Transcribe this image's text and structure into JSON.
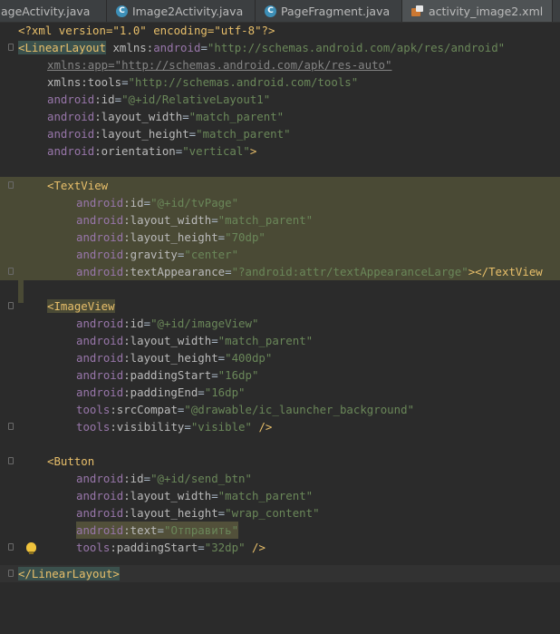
{
  "tabs": [
    {
      "label": "ageActivity.java",
      "icon": "none"
    },
    {
      "label": "Image2Activity.java",
      "icon": "java-class-icon"
    },
    {
      "label": "PageFragment.java",
      "icon": "java-class-icon"
    },
    {
      "label": "activity_image2.xml",
      "icon": "xml-layout-icon"
    }
  ],
  "icon_letter": "C",
  "code": {
    "l1": {
      "a": "<?xml version=\"1.0\" encoding=\"utf-8\"?>"
    },
    "l2": {
      "tag": "<LinearLayout",
      "ns": "xmlns:",
      "attr": "android",
      "eq": "=",
      "val": "\"http://schemas.android.com/apk/res/android\""
    },
    "l3": {
      "attr": "xmlns:app",
      "eq": "=",
      "val": "\"http://schemas.android.com/apk/res-auto\""
    },
    "l4": {
      "attr": "xmlns:tools",
      "eq": "=",
      "val": "\"http://schemas.android.com/tools\""
    },
    "l5": {
      "ns": "android",
      "attr": ":id",
      "eq": "=",
      "val": "\"@+id/RelativeLayout1\""
    },
    "l6": {
      "ns": "android",
      "attr": ":layout_width",
      "eq": "=",
      "val": "\"match_parent\""
    },
    "l7": {
      "ns": "android",
      "attr": ":layout_height",
      "eq": "=",
      "val": "\"match_parent\""
    },
    "l8": {
      "ns": "android",
      "attr": ":orientation",
      "eq": "=",
      "val": "\"vertical\"",
      "end": ">"
    },
    "l10": {
      "tag": "<TextView"
    },
    "l11": {
      "ns": "android",
      "attr": ":id",
      "eq": "=",
      "val": "\"@+id/tvPage\""
    },
    "l12": {
      "ns": "android",
      "attr": ":layout_width",
      "eq": "=",
      "val": "\"match_parent\""
    },
    "l13": {
      "ns": "android",
      "attr": ":layout_height",
      "eq": "=",
      "val": "\"70dp\""
    },
    "l14": {
      "ns": "android",
      "attr": ":gravity",
      "eq": "=",
      "val": "\"center\""
    },
    "l15": {
      "ns": "android",
      "attr": ":textAppearance",
      "eq": "=",
      "val": "\"?android:attr/textAppearanceLarge\"",
      "end": "></TextView"
    },
    "l17": {
      "tag": "<ImageView"
    },
    "l18": {
      "ns": "android",
      "attr": ":id",
      "eq": "=",
      "val": "\"@+id/imageView\""
    },
    "l19": {
      "ns": "android",
      "attr": ":layout_width",
      "eq": "=",
      "val": "\"match_parent\""
    },
    "l20": {
      "ns": "android",
      "attr": ":layout_height",
      "eq": "=",
      "val": "\"400dp\""
    },
    "l21": {
      "ns": "android",
      "attr": ":paddingStart",
      "eq": "=",
      "val": "\"16dp\""
    },
    "l22": {
      "ns": "android",
      "attr": ":paddingEnd",
      "eq": "=",
      "val": "\"16dp\""
    },
    "l23": {
      "ns": "tools",
      "attr": ":srcCompat",
      "eq": "=",
      "val": "\"@drawable/ic_launcher_background\""
    },
    "l24": {
      "ns": "tools",
      "attr": ":visibility",
      "eq": "=",
      "val": "\"visible\"",
      "end": " />"
    },
    "l26": {
      "tag": "<Button"
    },
    "l27": {
      "ns": "android",
      "attr": ":id",
      "eq": "=",
      "val": "\"@+id/send_btn\""
    },
    "l28": {
      "ns": "android",
      "attr": ":layout_width",
      "eq": "=",
      "val": "\"match_parent\""
    },
    "l29": {
      "ns": "android",
      "attr": ":layout_height",
      "eq": "=",
      "val": "\"wrap_content\""
    },
    "l30": {
      "ns": "android",
      "attr": ":text",
      "eq": "=",
      "val": "\"Отправить\""
    },
    "l31": {
      "ns": "tools",
      "attr": ":paddingStart",
      "eq": "=",
      "val": "\"32dp\"",
      "end": " />"
    },
    "l33": {
      "tag": "</LinearLayout>"
    }
  }
}
